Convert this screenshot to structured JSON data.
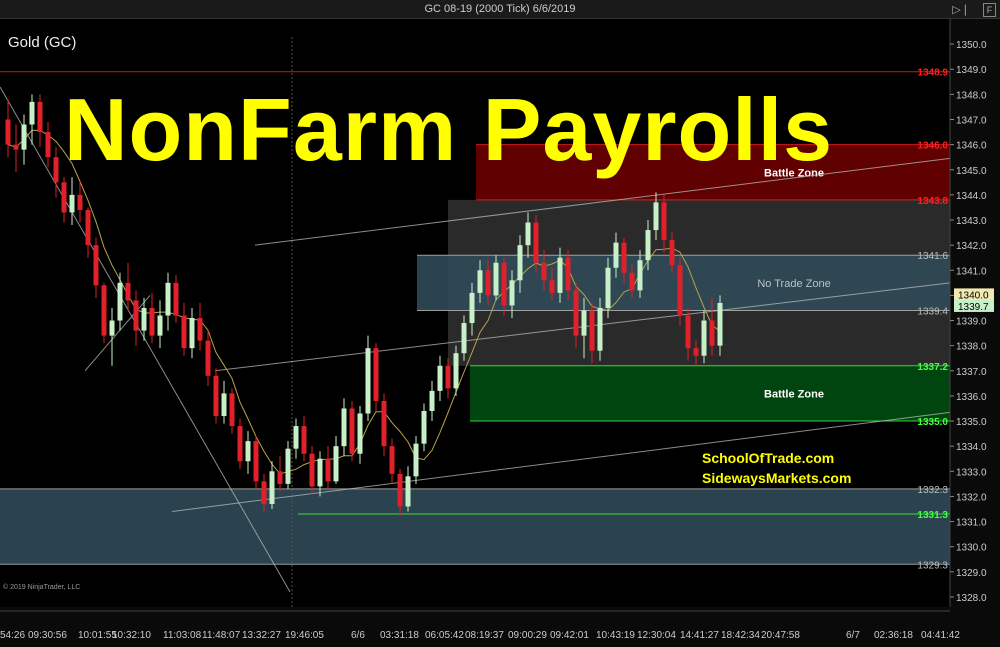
{
  "window": {
    "title": "GC 08-19 (2000 Tick)  6/6/2019",
    "icons": [
      "collapse-icon",
      "f-box-icon"
    ],
    "f_label": "F"
  },
  "instrument_label": "Gold (GC)",
  "headline": "NonFarm Payrolls",
  "sites": [
    "SchoolOfTrade.com",
    "SidewaysMarkets.com"
  ],
  "copyright": "© 2019 NinjaTrader, LLC",
  "colors": {
    "up_candle": "#c8f0c8",
    "down_candle": "#e0202a",
    "headline": "#ffff00",
    "battle_zone_upper": "#6a0000",
    "battle_zone_lower": "#004d12",
    "no_trade_zone": "#2f4a58",
    "range_box": "#2a2a2a"
  },
  "chart_data": {
    "type": "candlestick",
    "title": "GC 08-19 (2000 Tick)  6/6/2019",
    "ylim": [
      1327.6,
      1350.8
    ],
    "y_ticks": [
      1328.0,
      1329.0,
      1330.0,
      1331.0,
      1332.0,
      1333.0,
      1334.0,
      1335.0,
      1336.0,
      1337.0,
      1338.0,
      1339.0,
      1340.0,
      1341.0,
      1342.0,
      1343.0,
      1344.0,
      1345.0,
      1346.0,
      1347.0,
      1348.0,
      1349.0,
      1350.0
    ],
    "x_tick_labels": [
      "54:26",
      "09:30:56",
      "10:01:55",
      "10:32:10",
      "11:03:08",
      "11:48:07",
      "13:32:27",
      "19:46:05",
      "6/6",
      "03:31:18",
      "06:05:42",
      "08:19:37",
      "09:00:29",
      "09:42:01",
      "10:43:19",
      "12:30:04",
      "14:41:27",
      "18:42:34",
      "20:47:58",
      "6/7",
      "02:36:18",
      "04:41:42"
    ],
    "last_price_labels": [
      "1340.0",
      "1339.7"
    ],
    "zones": [
      {
        "name": "Battle Zone",
        "low": 1343.8,
        "high": 1346.0,
        "color_key": "battle_zone_upper"
      },
      {
        "name": "No Trade Zone",
        "low": 1339.4,
        "high": 1341.6,
        "color_key": "no_trade_zone"
      },
      {
        "name": "Battle Zone",
        "low": 1335.0,
        "high": 1337.2,
        "color_key": "battle_zone_lower"
      },
      {
        "name": "",
        "low": 1329.3,
        "high": 1332.3,
        "color_key": "no_trade_zone"
      }
    ],
    "levels": [
      {
        "value": 1348.9,
        "label": "1348.9",
        "color": "#ff2020"
      },
      {
        "value": 1346.0,
        "label": "1346.0",
        "color": "#ff2020"
      },
      {
        "value": 1343.8,
        "label": "1343.8",
        "color": "#ff2020"
      },
      {
        "value": 1341.6,
        "label": "1341.6",
        "color": "#bbbbbb"
      },
      {
        "value": 1339.4,
        "label": "1339.4",
        "color": "#bbbbbb"
      },
      {
        "value": 1337.2,
        "label": "1337.2",
        "color": "#44ff44"
      },
      {
        "value": 1335.0,
        "label": "1335.0",
        "color": "#44ff44"
      },
      {
        "value": 1332.3,
        "label": "1332.3",
        "color": "#bbbbbb"
      },
      {
        "value": 1331.3,
        "label": "1331.3",
        "color": "#44ff44"
      },
      {
        "value": 1329.3,
        "label": "1329.3",
        "color": "#bbbbbb"
      }
    ],
    "candles": [
      [
        1347.0,
        1347.8,
        1345.5,
        1346.0
      ],
      [
        1346.0,
        1346.8,
        1344.9,
        1345.8
      ],
      [
        1345.8,
        1347.2,
        1345.2,
        1346.8
      ],
      [
        1346.8,
        1348.0,
        1346.0,
        1347.7
      ],
      [
        1347.7,
        1348.0,
        1345.9,
        1346.5
      ],
      [
        1346.5,
        1346.9,
        1345.1,
        1345.5
      ],
      [
        1345.5,
        1345.9,
        1343.9,
        1344.5
      ],
      [
        1344.5,
        1344.7,
        1342.9,
        1343.3
      ],
      [
        1343.3,
        1344.7,
        1342.8,
        1344.0
      ],
      [
        1344.0,
        1344.5,
        1342.9,
        1343.4
      ],
      [
        1343.4,
        1343.5,
        1341.5,
        1342.0
      ],
      [
        1342.0,
        1342.3,
        1339.9,
        1340.4
      ],
      [
        1340.4,
        1340.5,
        1338.1,
        1338.4
      ],
      [
        1338.4,
        1339.5,
        1337.2,
        1339.0
      ],
      [
        1339.0,
        1340.9,
        1338.6,
        1340.5
      ],
      [
        1340.5,
        1341.3,
        1339.4,
        1339.8
      ],
      [
        1339.8,
        1340.2,
        1338.0,
        1338.6
      ],
      [
        1338.6,
        1339.9,
        1338.2,
        1339.5
      ],
      [
        1339.5,
        1340.1,
        1338.1,
        1338.4
      ],
      [
        1338.4,
        1339.8,
        1337.9,
        1339.2
      ],
      [
        1339.2,
        1340.9,
        1338.6,
        1340.5
      ],
      [
        1340.5,
        1340.8,
        1338.9,
        1339.2
      ],
      [
        1339.2,
        1339.7,
        1337.6,
        1337.9
      ],
      [
        1337.9,
        1339.5,
        1337.5,
        1339.1
      ],
      [
        1339.1,
        1339.7,
        1337.8,
        1338.2
      ],
      [
        1338.2,
        1338.6,
        1336.4,
        1336.8
      ],
      [
        1336.8,
        1337.1,
        1334.9,
        1335.2
      ],
      [
        1335.2,
        1336.6,
        1334.9,
        1336.1
      ],
      [
        1336.1,
        1336.3,
        1334.5,
        1334.8
      ],
      [
        1334.8,
        1335.1,
        1333.1,
        1333.4
      ],
      [
        1333.4,
        1334.6,
        1332.9,
        1334.2
      ],
      [
        1334.2,
        1334.4,
        1332.3,
        1332.6
      ],
      [
        1332.6,
        1332.9,
        1331.4,
        1331.7
      ],
      [
        1331.7,
        1333.4,
        1331.5,
        1333.0
      ],
      [
        1333.0,
        1333.6,
        1332.2,
        1332.5
      ],
      [
        1332.5,
        1334.2,
        1332.3,
        1333.9
      ],
      [
        1333.9,
        1335.1,
        1333.5,
        1334.8
      ],
      [
        1334.8,
        1335.2,
        1333.4,
        1333.7
      ],
      [
        1333.7,
        1334.0,
        1332.1,
        1332.4
      ],
      [
        1332.4,
        1333.8,
        1332.0,
        1333.5
      ],
      [
        1333.5,
        1334.0,
        1332.3,
        1332.6
      ],
      [
        1332.6,
        1334.4,
        1332.5,
        1334.0
      ],
      [
        1334.0,
        1335.9,
        1333.6,
        1335.5
      ],
      [
        1335.5,
        1335.8,
        1333.4,
        1333.7
      ],
      [
        1333.7,
        1335.6,
        1333.3,
        1335.3
      ],
      [
        1335.3,
        1338.4,
        1335.0,
        1337.9
      ],
      [
        1337.9,
        1338.1,
        1335.4,
        1335.8
      ],
      [
        1335.8,
        1336.1,
        1333.6,
        1334.0
      ],
      [
        1334.0,
        1334.3,
        1332.5,
        1332.9
      ],
      [
        1332.9,
        1333.1,
        1331.2,
        1331.6
      ],
      [
        1331.6,
        1333.2,
        1331.4,
        1332.8
      ],
      [
        1332.8,
        1334.4,
        1332.5,
        1334.1
      ],
      [
        1334.1,
        1335.7,
        1333.8,
        1335.4
      ],
      [
        1335.4,
        1336.6,
        1335.0,
        1336.2
      ],
      [
        1336.2,
        1337.6,
        1335.8,
        1337.2
      ],
      [
        1337.2,
        1337.5,
        1335.9,
        1336.3
      ],
      [
        1336.3,
        1338.0,
        1336.0,
        1337.7
      ],
      [
        1337.7,
        1339.2,
        1337.4,
        1338.9
      ],
      [
        1338.9,
        1340.5,
        1338.4,
        1340.1
      ],
      [
        1340.1,
        1341.4,
        1339.7,
        1341.0
      ],
      [
        1341.0,
        1341.4,
        1339.6,
        1340.0
      ],
      [
        1340.0,
        1341.6,
        1339.8,
        1341.3
      ],
      [
        1341.3,
        1341.5,
        1339.2,
        1339.6
      ],
      [
        1339.6,
        1341.0,
        1339.1,
        1340.6
      ],
      [
        1340.6,
        1342.4,
        1340.1,
        1342.0
      ],
      [
        1342.0,
        1343.3,
        1341.5,
        1342.9
      ],
      [
        1342.9,
        1343.2,
        1340.9,
        1341.3
      ],
      [
        1341.3,
        1341.8,
        1340.2,
        1340.6
      ],
      [
        1340.6,
        1341.1,
        1339.8,
        1340.1
      ],
      [
        1340.1,
        1341.9,
        1339.7,
        1341.5
      ],
      [
        1341.5,
        1341.8,
        1339.8,
        1340.2
      ],
      [
        1340.2,
        1340.5,
        1337.9,
        1338.4
      ],
      [
        1338.4,
        1339.9,
        1337.5,
        1339.4
      ],
      [
        1339.4,
        1339.7,
        1337.3,
        1337.8
      ],
      [
        1337.8,
        1339.9,
        1337.4,
        1339.5
      ],
      [
        1339.5,
        1341.5,
        1339.1,
        1341.1
      ],
      [
        1341.1,
        1342.5,
        1340.7,
        1342.1
      ],
      [
        1342.1,
        1342.3,
        1340.5,
        1340.9
      ],
      [
        1340.9,
        1341.2,
        1339.9,
        1340.2
      ],
      [
        1340.2,
        1341.8,
        1339.9,
        1341.4
      ],
      [
        1341.4,
        1343.0,
        1341.0,
        1342.6
      ],
      [
        1342.6,
        1344.1,
        1342.2,
        1343.7
      ],
      [
        1343.7,
        1344.0,
        1341.7,
        1342.2
      ],
      [
        1342.2,
        1342.5,
        1340.9,
        1341.2
      ],
      [
        1341.2,
        1341.5,
        1338.8,
        1339.2
      ],
      [
        1339.2,
        1339.5,
        1337.4,
        1337.9
      ],
      [
        1337.9,
        1338.2,
        1337.2,
        1337.6
      ],
      [
        1337.6,
        1339.4,
        1337.3,
        1339.0
      ],
      [
        1339.0,
        1339.9,
        1337.6,
        1338.0
      ],
      [
        1338.0,
        1340.0,
        1337.6,
        1339.7
      ]
    ]
  }
}
